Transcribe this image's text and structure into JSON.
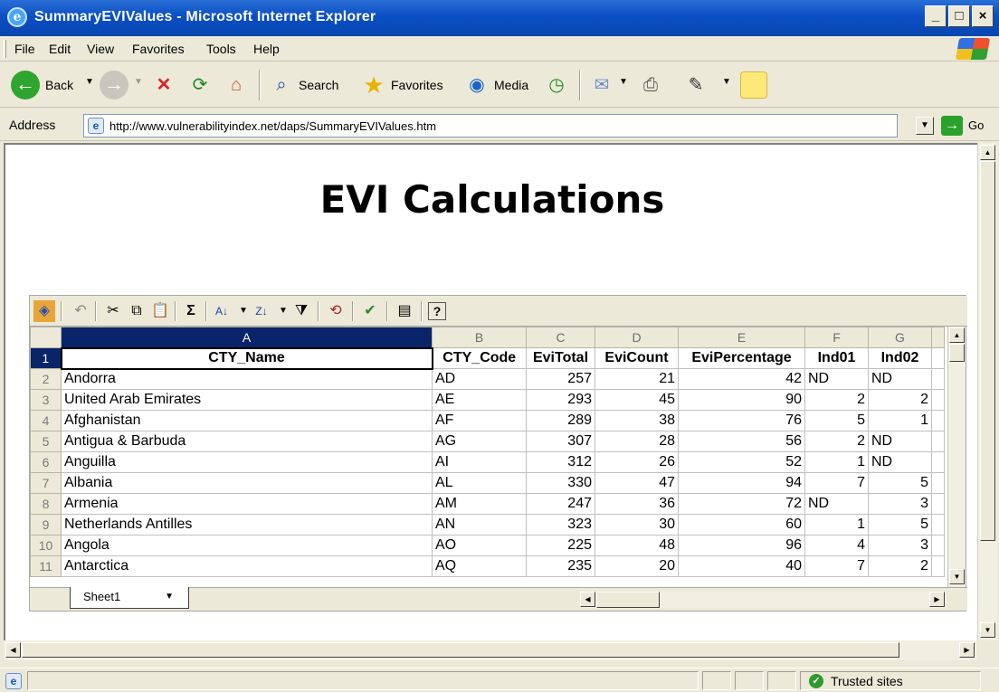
{
  "window": {
    "title": "SummaryEVIValues - Microsoft Internet Explorer"
  },
  "menubar": [
    "File",
    "Edit",
    "View",
    "Favorites",
    "Tools",
    "Help"
  ],
  "toolbar": {
    "back_label": "Back",
    "search_label": "Search",
    "favorites_label": "Favorites",
    "media_label": "Media"
  },
  "address": {
    "label": "Address",
    "url": "http://www.vulnerabilityindex.net/daps/SummaryEVIValues.htm",
    "go_label": "Go"
  },
  "page": {
    "heading": "EVI Calculations"
  },
  "spreadsheet": {
    "column_letters": [
      "A",
      "B",
      "C",
      "D",
      "E",
      "F",
      "G"
    ],
    "header_row": [
      "CTY_Name",
      "CTY_Code",
      "EviTotal",
      "EviCount",
      "EviPercentage",
      "Ind01",
      "Ind02"
    ],
    "rows": [
      {
        "num": "2",
        "cells": [
          "Andorra",
          "AD",
          "257",
          "21",
          "42",
          "ND",
          "ND"
        ]
      },
      {
        "num": "3",
        "cells": [
          "United Arab Emirates",
          "AE",
          "293",
          "45",
          "90",
          "2",
          "2"
        ]
      },
      {
        "num": "4",
        "cells": [
          "Afghanistan",
          "AF",
          "289",
          "38",
          "76",
          "5",
          "1"
        ]
      },
      {
        "num": "5",
        "cells": [
          "Antigua & Barbuda",
          "AG",
          "307",
          "28",
          "56",
          "2",
          "ND"
        ]
      },
      {
        "num": "6",
        "cells": [
          "Anguilla",
          "AI",
          "312",
          "26",
          "52",
          "1",
          "ND"
        ]
      },
      {
        "num": "7",
        "cells": [
          "Albania",
          "AL",
          "330",
          "47",
          "94",
          "7",
          "5"
        ]
      },
      {
        "num": "8",
        "cells": [
          "Armenia",
          "AM",
          "247",
          "36",
          "72",
          "ND",
          "3"
        ]
      },
      {
        "num": "9",
        "cells": [
          "Netherlands Antilles",
          "AN",
          "323",
          "30",
          "60",
          "1",
          "5"
        ]
      },
      {
        "num": "10",
        "cells": [
          "Angola",
          "AO",
          "225",
          "48",
          "96",
          "4",
          "3"
        ]
      },
      {
        "num": "11",
        "cells": [
          "Antarctica",
          "AQ",
          "235",
          "20",
          "40",
          "7",
          "2"
        ]
      }
    ],
    "sheet_tab": "Sheet1"
  },
  "statusbar": {
    "zone": "Trusted sites"
  },
  "colors": {
    "titlebar": "#0a4fc4",
    "selection": "#0a246a",
    "chrome": "#ece9d8"
  }
}
